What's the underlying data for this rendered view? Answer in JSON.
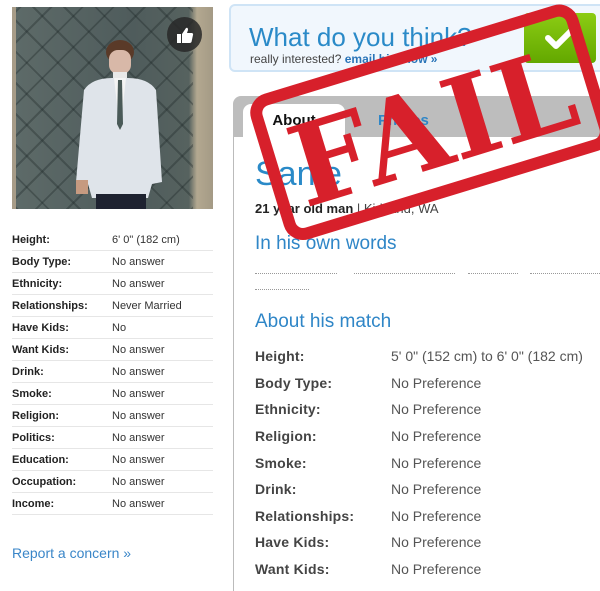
{
  "profile": {
    "name": "Sanie",
    "age_prefix": "21",
    "age_rest": " year old man",
    "location": "Kirkland, WA",
    "separator": " | "
  },
  "left_attributes": [
    {
      "label": "Height:",
      "value": "6' 0\" (182 cm)"
    },
    {
      "label": "Body Type:",
      "value": "No answer"
    },
    {
      "label": "Ethnicity:",
      "value": "No answer"
    },
    {
      "label": "Relationships:",
      "value": "Never Married"
    },
    {
      "label": "Have Kids:",
      "value": "No"
    },
    {
      "label": "Want Kids:",
      "value": "No answer"
    },
    {
      "label": "Drink:",
      "value": "No answer"
    },
    {
      "label": "Smoke:",
      "value": "No answer"
    },
    {
      "label": "Religion:",
      "value": "No answer"
    },
    {
      "label": "Politics:",
      "value": "No answer"
    },
    {
      "label": "Education:",
      "value": "No answer"
    },
    {
      "label": "Occupation:",
      "value": "No answer"
    },
    {
      "label": "Income:",
      "value": "No answer"
    }
  ],
  "report_link": "Report a concern »",
  "think_box": {
    "title": "What do you think?",
    "sub_prefix": "really interested? ",
    "sub_link": "email him now »"
  },
  "tabs": [
    {
      "label": "About",
      "active": true
    },
    {
      "label": "Photos",
      "active": false
    }
  ],
  "sections": {
    "own_words": "In his own words",
    "about_match": "About his match"
  },
  "match_prefs": [
    {
      "label": "Height:",
      "value": "5' 0\" (152 cm) to 6' 0\" (182 cm)"
    },
    {
      "label": "Body Type:",
      "value": "No Preference"
    },
    {
      "label": "Ethnicity:",
      "value": "No Preference"
    },
    {
      "label": "Religion:",
      "value": "No Preference"
    },
    {
      "label": "Smoke:",
      "value": "No Preference"
    },
    {
      "label": "Drink:",
      "value": "No Preference"
    },
    {
      "label": "Relationships:",
      "value": "No Preference"
    },
    {
      "label": "Have Kids:",
      "value": "No Preference"
    },
    {
      "label": "Want Kids:",
      "value": "No Preference"
    }
  ],
  "stamp": {
    "text": "FAIL",
    "color": "#d7202b"
  },
  "colors": {
    "link": "#2a8ac8",
    "accent_green": "#6db008",
    "tab_bar": "#bdbdbd"
  }
}
